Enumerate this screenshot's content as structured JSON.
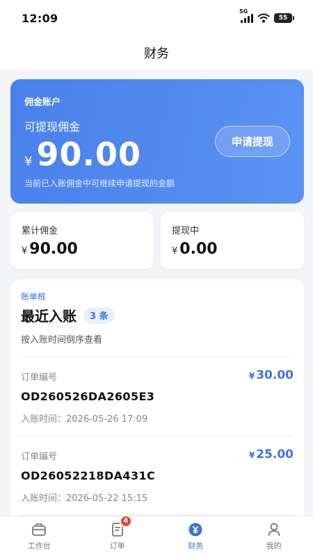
{
  "status_bar": {
    "time": "12:09",
    "network": "5G",
    "battery": "55"
  },
  "nav": {
    "title": "财务"
  },
  "hero": {
    "account_label": "佣金账户",
    "withdrawable_label": "可提现佣金",
    "currency": "¥",
    "amount": "90.00",
    "hint": "当前已入账佣金中可继续申请提现的金额",
    "withdraw_button": "申请提现"
  },
  "stats": [
    {
      "label": "累计佣金",
      "currency": "¥",
      "value": "90.00"
    },
    {
      "label": "提现中",
      "currency": "¥",
      "value": "0.00"
    }
  ],
  "bill": {
    "tag": "账单框",
    "title": "最近入账",
    "count_badge": "3 条",
    "description": "按入账时间倒序查看",
    "entries": [
      {
        "order_label": "订单编号",
        "order_id": "OD260526DA2605E3",
        "time": "入账时间：2026-05-26 17:09",
        "currency": "¥",
        "amount": "30.00"
      },
      {
        "order_label": "订单编号",
        "order_id": "OD26052218DA431C",
        "time": "入账时间：2026-05-22 15:15",
        "currency": "¥",
        "amount": "25.00"
      }
    ]
  },
  "tabbar": {
    "items": [
      {
        "label": "工作台",
        "icon": "workbench-icon"
      },
      {
        "label": "订单",
        "icon": "order-icon",
        "badge": "4"
      },
      {
        "label": "财务",
        "icon": "finance-icon"
      },
      {
        "label": "我的",
        "icon": "profile-icon"
      }
    ],
    "active_index": 2,
    "accent": "#3f73d8"
  }
}
